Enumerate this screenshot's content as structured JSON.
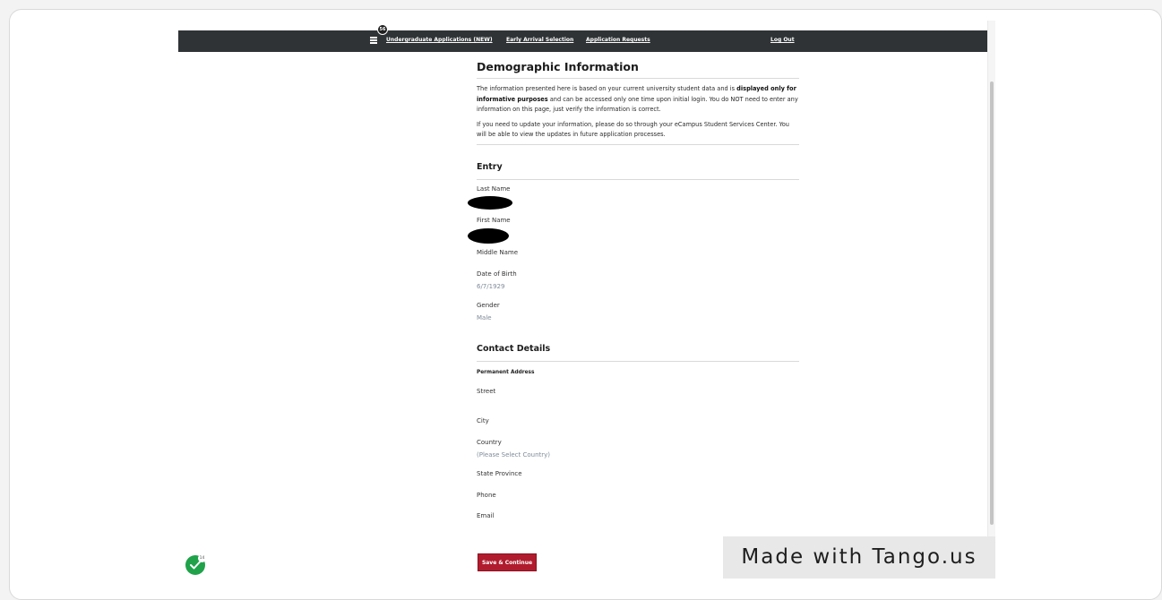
{
  "nav": {
    "badge_count": "56",
    "links": [
      "Undergraduate Applications (NEW)",
      "Early Arrival Selection",
      "Application Requests"
    ],
    "logout": "Log Out"
  },
  "page": {
    "title": "Demographic Information",
    "para1_part1": "The information presented here is based on your current university student data and is ",
    "para1_bold": "displayed only for informative purposes",
    "para1_part2": " and can be accessed only one time upon initial login. You do NOT need to enter any information on this page, just verify the information is correct.",
    "para2": "If you need to update your information, please do so through your eCampus Student Services Center. You will be able to view the updates in future application processes."
  },
  "entry": {
    "heading": "Entry",
    "last_name_label": "Last Name",
    "first_name_label": "First Name",
    "middle_name_label": "Middle Name",
    "dob_label": "Date of Birth",
    "dob_value": "6/7/1929",
    "gender_label": "Gender",
    "gender_value": "Male"
  },
  "contact": {
    "heading": "Contact Details",
    "permanent_address_label": "Permanent Address",
    "street_label": "Street",
    "city_label": "City",
    "country_label": "Country",
    "country_value": "(Please Select Country)",
    "state_label": "State Province",
    "phone_label": "Phone",
    "email_label": "Email"
  },
  "actions": {
    "save_label": "Save & Continue"
  },
  "watermark": "Made with Tango.us",
  "check_badge": "14",
  "colors": {
    "navbar": "#2f3335",
    "save_button": "#b01c2e",
    "value_text": "#7f8b99",
    "check": "#1fa24a"
  }
}
